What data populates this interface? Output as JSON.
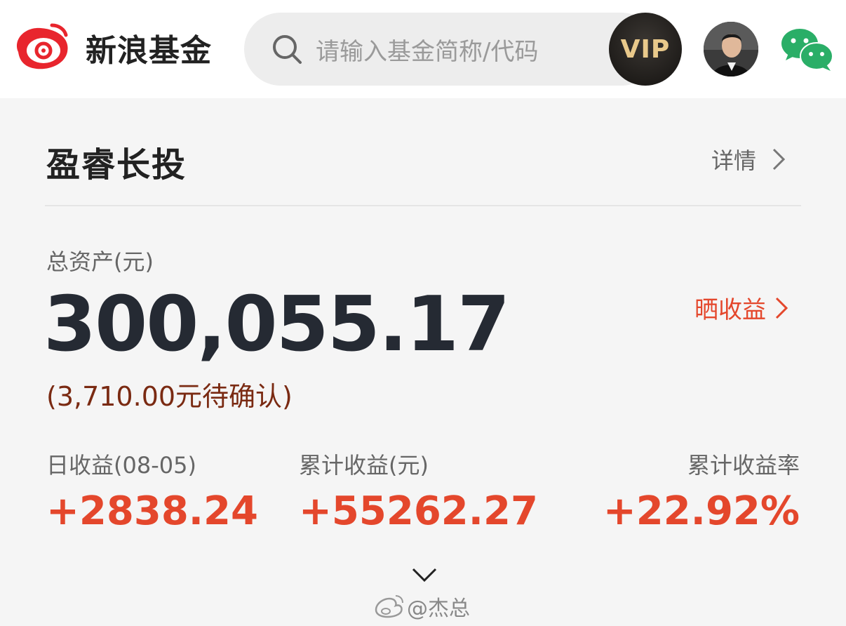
{
  "header": {
    "brand": "新浪基金",
    "search_placeholder": "请输入基金简称/代码",
    "vip_label": "VIP",
    "icons": [
      "sina-logo-icon",
      "search-icon",
      "avatar",
      "wechat-icon"
    ]
  },
  "card": {
    "title": "盈睿长投",
    "detail_label": "详情",
    "total_label": "总资产(元)",
    "total_value": "300,055.17",
    "pending": "(3,710.00元待确认)",
    "share_label": "晒收益",
    "stats": [
      {
        "label": "日收益(08-05)",
        "value": "+2838.24"
      },
      {
        "label": "累计收益(元)",
        "value": "+55262.27"
      },
      {
        "label": "累计收益率",
        "value": "+22.92%"
      }
    ]
  },
  "watermark": "@杰总",
  "colors": {
    "accent": "#e4472c",
    "pending": "#7a2a12",
    "vip_gold": "#e9c98b"
  }
}
